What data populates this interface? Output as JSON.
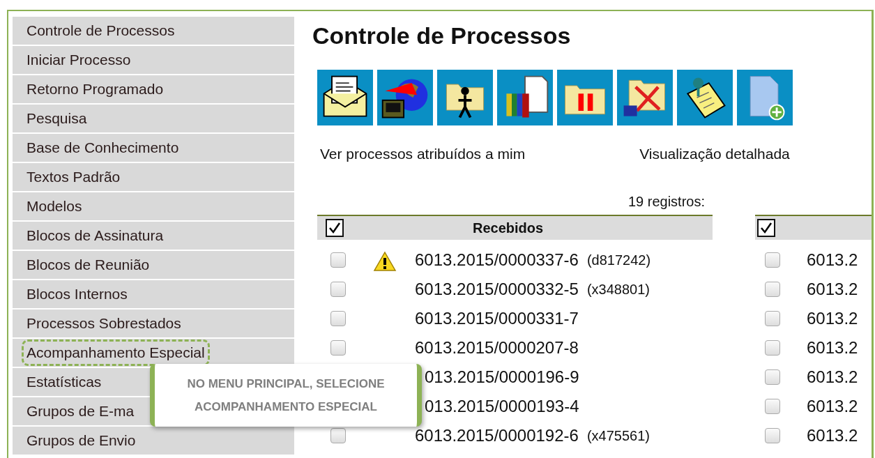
{
  "sidebar": {
    "items": [
      {
        "label": "Controle de Processos",
        "highlighted": false
      },
      {
        "label": "Iniciar Processo",
        "highlighted": false
      },
      {
        "label": "Retorno Programado",
        "highlighted": false
      },
      {
        "label": "Pesquisa",
        "highlighted": false
      },
      {
        "label": "Base de Conhecimento",
        "highlighted": false
      },
      {
        "label": "Textos Padrão",
        "highlighted": false
      },
      {
        "label": "Modelos",
        "highlighted": false
      },
      {
        "label": "Blocos de Assinatura",
        "highlighted": false
      },
      {
        "label": "Blocos de Reunião",
        "highlighted": false
      },
      {
        "label": "Blocos Internos",
        "highlighted": false
      },
      {
        "label": "Processos Sobrestados",
        "highlighted": false
      },
      {
        "label": "Acompanhamento Especial",
        "highlighted": true
      },
      {
        "label": "Estatísticas",
        "highlighted": false
      },
      {
        "label": "Grupos de E-ma",
        "highlighted": false
      },
      {
        "label": "Grupos de Envio",
        "highlighted": false
      }
    ]
  },
  "page_title": "Controle de Processos",
  "links": [
    "Ver processos atribuídos a mim",
    "Visualização detalhada"
  ],
  "record_count": "19 registros:",
  "received_table": {
    "title": "Recebidos",
    "all_checked": true,
    "rows": [
      {
        "number": "6013.2015/0000337-6",
        "tag": "(d817242)",
        "alert": true,
        "checked": false
      },
      {
        "number": "6013.2015/0000332-5",
        "tag": "(x348801)",
        "alert": false,
        "checked": false
      },
      {
        "number": "6013.2015/0000331-7",
        "alert": false,
        "checked": false
      },
      {
        "number": "6013.2015/0000207-8",
        "alert": false,
        "checked": false
      },
      {
        "number": "013.2015/0000196-9",
        "alert": false
      },
      {
        "number": "013.2015/0000193-4",
        "alert": false
      },
      {
        "number": "6013.2015/0000192-6",
        "tag": "(x475561)",
        "alert": false,
        "checked": false
      }
    ]
  },
  "generated_table": {
    "all_checked": true,
    "rows": [
      {
        "number": "6013.2",
        "checked": false
      },
      {
        "number": "6013.2",
        "checked": false
      },
      {
        "number": "6013.2",
        "checked": false
      },
      {
        "number": "6013.2",
        "checked": false
      },
      {
        "number": "6013.2",
        "checked": false
      },
      {
        "number": "6013.2",
        "checked": false
      },
      {
        "number": "6013.2",
        "checked": false
      }
    ]
  },
  "callout": {
    "text": "NO MENU PRINCIPAL, SELECIONE ACOMPANHAMENTO ESPECIAL"
  }
}
